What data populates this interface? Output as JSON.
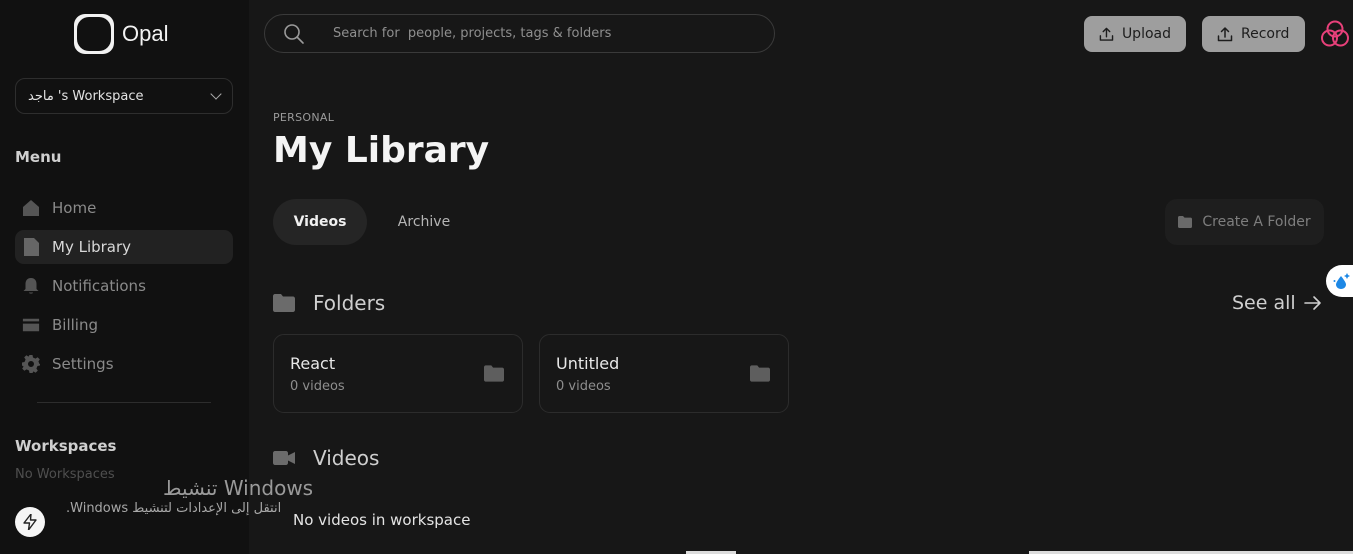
{
  "brand": {
    "name": "Opal"
  },
  "workspace_select": {
    "value": "ماجد 's Workspace"
  },
  "sidebar": {
    "menu_title": "Menu",
    "items": [
      {
        "label": "Home",
        "icon": "home-icon"
      },
      {
        "label": "My Library",
        "icon": "document-icon",
        "active": true
      },
      {
        "label": "Notifications",
        "icon": "bell-icon"
      },
      {
        "label": "Billing",
        "icon": "credit-card-icon"
      },
      {
        "label": "Settings",
        "icon": "gear-icon"
      }
    ],
    "workspaces_title": "Workspaces",
    "workspaces_empty": "No Workspaces"
  },
  "search": {
    "placeholder": "Search for  people, projects, tags & folders"
  },
  "topbar": {
    "upload_label": "Upload",
    "record_label": "Record"
  },
  "main": {
    "eyebrow": "PERSONAL",
    "title": "My Library",
    "tabs": [
      {
        "label": "Videos",
        "active": true
      },
      {
        "label": "Archive"
      }
    ],
    "create_folder_label": "Create A Folder",
    "folders_heading": "Folders",
    "see_all_label": "See all",
    "folders": [
      {
        "name": "React",
        "count": "0 videos"
      },
      {
        "name": "Untitled",
        "count": "0 videos"
      }
    ],
    "videos_heading": "Videos",
    "empty_message": "No videos in workspace"
  },
  "os_overlay": {
    "title": "تنشيط Windows",
    "subtitle": "انتقل إلى الإعدادات لتنشيط Windows."
  },
  "colors": {
    "background": "#171717",
    "sidebar": "#111111",
    "button": "#9e9e9e"
  }
}
